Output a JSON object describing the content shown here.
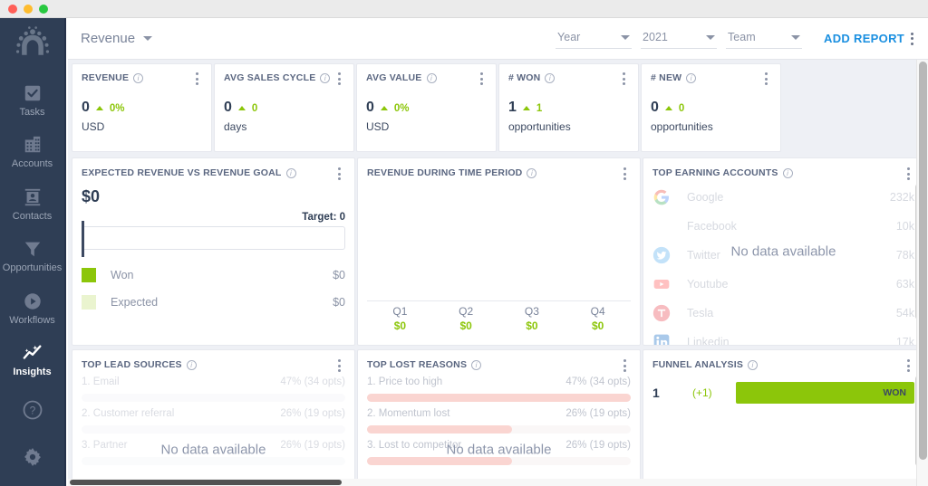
{
  "window": {
    "traffic_lights": [
      "close",
      "minimize",
      "maximize"
    ]
  },
  "sidebar": {
    "logo": "beaded-circle-logo",
    "items": [
      {
        "label": "Tasks",
        "icon": "checkbox-icon",
        "active": false
      },
      {
        "label": "Accounts",
        "icon": "building-icon",
        "active": false
      },
      {
        "label": "Contacts",
        "icon": "contact-card-icon",
        "active": false
      },
      {
        "label": "Opportunities",
        "icon": "funnel-icon",
        "active": false
      },
      {
        "label": "Workflows",
        "icon": "play-circle-icon",
        "active": false
      },
      {
        "label": "Insights",
        "icon": "sparkline-icon",
        "active": true
      }
    ],
    "bottom": [
      {
        "label": "Help",
        "icon": "question-circle-icon"
      },
      {
        "label": "Settings",
        "icon": "gear-icon"
      }
    ]
  },
  "topbar": {
    "report_name": "Revenue",
    "filters": [
      {
        "name": "period-filter",
        "value": "Year"
      },
      {
        "name": "year-filter",
        "value": "2021"
      },
      {
        "name": "team-filter",
        "value": "Team"
      }
    ],
    "add_report_label": "ADD REPORT"
  },
  "kpis": [
    {
      "title": "REVENUE",
      "value": "0",
      "delta": "0%",
      "trend": "up",
      "unit": "USD"
    },
    {
      "title": "AVG SALES CYCLE",
      "value": "0",
      "delta": "0",
      "trend": "up",
      "unit": "days"
    },
    {
      "title": "AVG VALUE",
      "value": "0",
      "delta": "0%",
      "trend": "up",
      "unit": "USD"
    },
    {
      "title": "# WON",
      "value": "1",
      "delta": "1",
      "trend": "up",
      "unit": "opportunities"
    },
    {
      "title": "# NEW",
      "value": "0",
      "delta": "0",
      "trend": "up",
      "unit": "opportunities"
    }
  ],
  "expected_revenue": {
    "title": "EXPECTED REVENUE VS REVENUE GOAL",
    "amount": "$0",
    "target_label": "Target: 0",
    "legend": [
      {
        "label": "Won",
        "value": "$0",
        "color": "#8cc60a"
      },
      {
        "label": "Expected",
        "value": "$0",
        "color": "#eaf4cf"
      }
    ]
  },
  "revenue_time": {
    "title": "REVENUE DURING TIME PERIOD",
    "quarters": [
      {
        "label": "Q1",
        "value": "$0"
      },
      {
        "label": "Q2",
        "value": "$0"
      },
      {
        "label": "Q3",
        "value": "$0"
      },
      {
        "label": "Q4",
        "value": "$0"
      }
    ]
  },
  "top_accounts": {
    "title": "TOP EARNING ACCOUNTS",
    "empty_message": "No data available",
    "rows": [
      {
        "name": "Google",
        "value": "232k",
        "icon": "google-icon"
      },
      {
        "name": "Facebook",
        "value": "10k",
        "icon": "facebook-icon"
      },
      {
        "name": "Twitter",
        "value": "78k",
        "icon": "twitter-icon"
      },
      {
        "name": "Youtube",
        "value": "63k",
        "icon": "youtube-icon"
      },
      {
        "name": "Tesla",
        "value": "54k",
        "icon": "tesla-icon"
      },
      {
        "name": "Linkedin",
        "value": "17k",
        "icon": "linkedin-icon"
      }
    ]
  },
  "top_lead_sources": {
    "title": "TOP LEAD SOURCES",
    "empty_message": "No data available",
    "rows": [
      {
        "label": "1. Email",
        "stat": "47% (34 opts)",
        "pct": 100
      },
      {
        "label": "2. Customer referral",
        "stat": "26% (19 opts)",
        "pct": 55
      },
      {
        "label": "3. Partner",
        "stat": "26% (19 opts)",
        "pct": 55
      }
    ]
  },
  "top_lost_reasons": {
    "title": "TOP LOST REASONS",
    "empty_message": "No data available",
    "bar_color": "#f6b3ad",
    "rows": [
      {
        "label": "1. Price too high",
        "stat": "47% (34 opts)",
        "pct": 100
      },
      {
        "label": "2. Momentum lost",
        "stat": "26% (19 opts)",
        "pct": 55
      },
      {
        "label": "3. Lost to competitor",
        "stat": "26% (19 opts)",
        "pct": 55
      }
    ]
  },
  "funnel": {
    "title": "FUNNEL ANALYSIS",
    "stages": [
      {
        "count": "1",
        "delta": "(+1)",
        "label": "WON",
        "width_pct": 100,
        "color": "#8cc60a"
      }
    ]
  },
  "colors": {
    "accent_blue": "#1a8fe0",
    "green": "#8cc60a",
    "sidebar": "#2f3e55",
    "text_dark": "#2f3e55",
    "text_muted": "#8b93a6",
    "page_bg": "#eef0f5"
  }
}
